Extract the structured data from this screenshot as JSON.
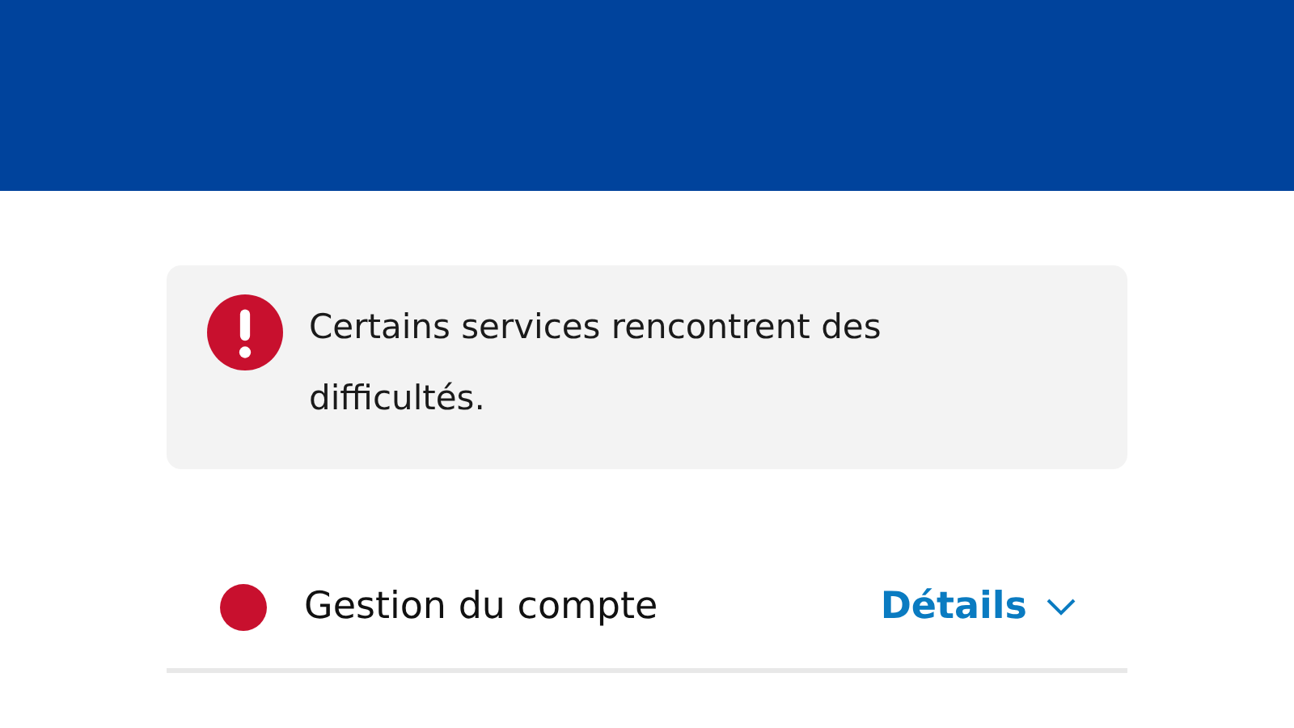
{
  "alert": {
    "text": "Certains services rencontrent des difficultés."
  },
  "services": [
    {
      "name": "Gestion du compte",
      "color": "#c8102e",
      "action": "Détails",
      "expanded": false
    }
  ]
}
